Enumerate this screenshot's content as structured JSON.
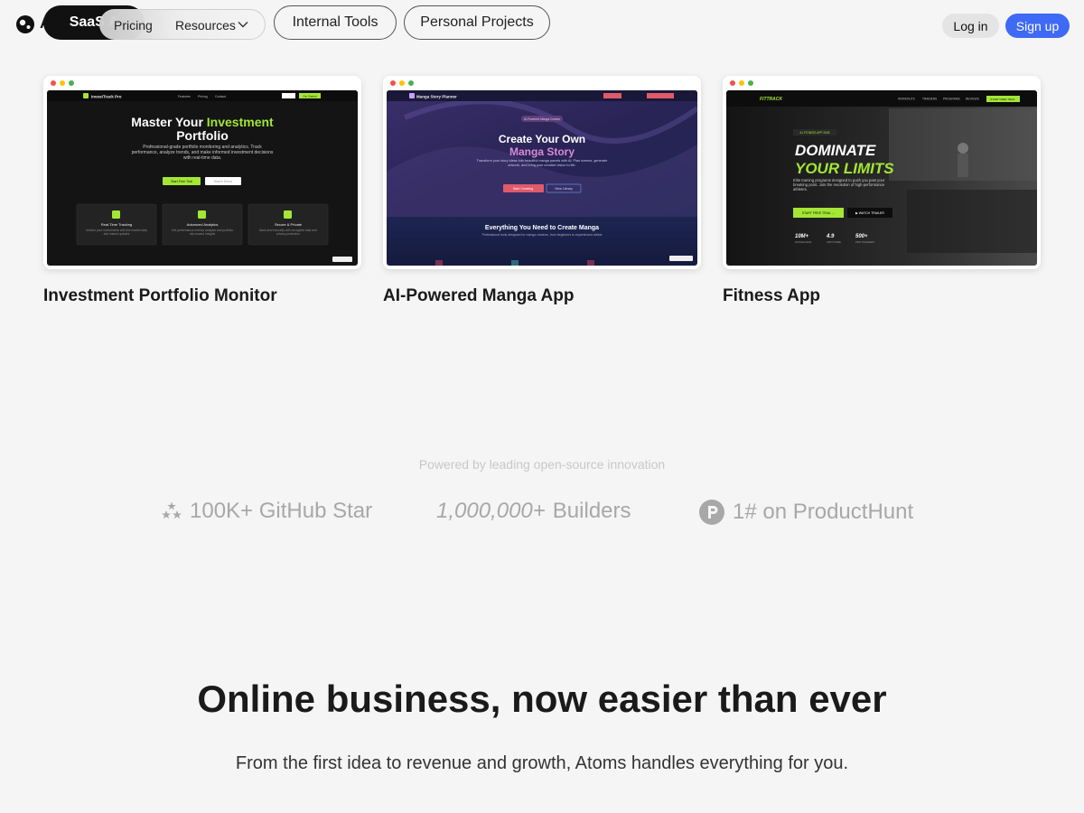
{
  "header": {
    "logo_text": "A",
    "tabs": [
      "SaaS A",
      "Internal Tools",
      "Personal Projects"
    ],
    "nav": {
      "pricing": "Pricing",
      "resources": "Resources"
    },
    "login": "Log in",
    "signup": "Sign up"
  },
  "cards": [
    {
      "title": "Investment Portfolio Monitor",
      "shot": {
        "brand": "InvestTrack Pro",
        "nav": [
          "Features",
          "Pricing",
          "Contact"
        ],
        "cta": "Get Started",
        "headline_a": "Master Your ",
        "headline_b": "Investment",
        "headline_c": "Portfolio",
        "body": "Professional-grade portfolio monitoring and analytics. Track performance, analyze trends, and make informed investment decisions with real-time data.",
        "btn_primary": "Start Free Trial",
        "btn_secondary": "Watch Demo",
        "features": [
          {
            "name": "Real-Time Tracking",
            "desc": "Monitor your investments with live market data and instant updates"
          },
          {
            "name": "Advanced Analytics",
            "desc": "Get performance metrics analysis and portfolio risk-reward insights"
          },
          {
            "name": "Secure & Private",
            "desc": "Bank-level security with encrypted data and privacy protection"
          }
        ]
      }
    },
    {
      "title": "AI-Powered Manga App",
      "shot": {
        "brand": "Manga Story Planner",
        "badge": "AI-Powered Manga Creator",
        "headline_a": "Create Your Own",
        "headline_b": "Manga Story",
        "body": "Transform your story ideas into beautiful manga panels with AI. Plan scenes, generate artwork, and bring your creative vision to life.",
        "btn_primary": "Start Creating",
        "btn_secondary": "View Library",
        "section": "Everything You Need to Create Manga",
        "section_sub": "Professional tools designed for manga creators, from beginners to experienced artists"
      }
    },
    {
      "title": "Fitness App",
      "shot": {
        "brand": "FITTRACK",
        "nav": [
          "WORKOUTS",
          "TRAINERS",
          "PROGRAMS",
          "REVIEWS"
        ],
        "cta": "START FREE TRIAL",
        "badge": "#1 FITNESS APP 2025",
        "headline_a": "DOMINATE",
        "headline_b": "YOUR LIMITS",
        "body": "Elite training programs designed to push you past your breaking point. Join the revolution of high-performance athletes.",
        "btn_primary": "START FREE TRIAL →",
        "btn_secondary": "▶ WATCH TRAILER",
        "stats": [
          {
            "value": "10M+",
            "label": "DOWNLOADS"
          },
          {
            "value": "4.9",
            "label": "APP STORE"
          },
          {
            "value": "500+",
            "label": "PRO TRAINERS"
          }
        ]
      }
    }
  ],
  "powered_text": "Powered by leading open-source innovation",
  "stats": {
    "github": "100K+ GitHub Star",
    "builders_number": "1,000,000+",
    "builders_label": "Builders",
    "producthunt": "1# on ProductHunt"
  },
  "hero": {
    "title": "Online business, now easier than ever",
    "subtitle": "From the first idea to revenue and growth, Atoms handles everything for you."
  },
  "colors": {
    "accent": "#3f6af5",
    "lime": "#a3e635",
    "manga_pink": "#e05a6a",
    "background": "#f5f5f5"
  }
}
